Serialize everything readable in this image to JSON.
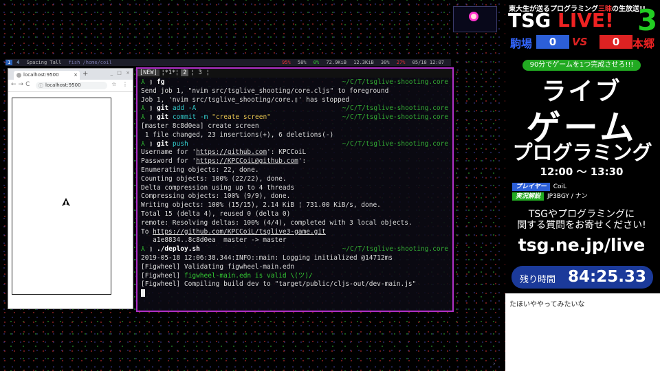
{
  "statusbar": {
    "ws1": "1",
    "ws4": "4",
    "layout": "Spacing Tall",
    "focused": "fish /home/coil",
    "cpu": "95%",
    "mem": "58%",
    "bat": "0%",
    "down": "72.9KiB",
    "up": "12.3KiB",
    "vol": "30%",
    "temp": "27%",
    "datetime": "05/18 12:07"
  },
  "browser": {
    "tab_title": "localhost:9500",
    "url": "localhost:9500",
    "new_tab": "+",
    "tab_close": "×",
    "nav": "←→C",
    "right_icons": "☆ ⋮",
    "win_buttons": "_ □ ×"
  },
  "terminal": {
    "tabs": [
      "[NEW]",
      "¦*1*¦",
      "2",
      "¦",
      "3",
      "¦"
    ],
    "prompt_glyph": "⅄",
    "lines": [
      {
        "kind": "cmd",
        "cmd": "fg",
        "path": "~/C/T/tsglive-shooting.core"
      },
      {
        "kind": "text",
        "text": "Send job 1, \"nvim src/tsglive_shooting/core.cljs\" to foreground"
      },
      {
        "kind": "text",
        "text": "Job 1, 'nvim src/tsglive_shooting/core.▯' has stopped"
      },
      {
        "kind": "cmd",
        "cmd": "git",
        "arg": "add -A",
        "path": "~/C/T/tsglive-shooting.core"
      },
      {
        "kind": "cmd",
        "cmd": "git",
        "arg": "commit -m",
        "str": "\"create screen\"",
        "path": "~/C/T/tsglive-shooting.core"
      },
      {
        "kind": "text",
        "text": "[master 8c8d0ea] create screen"
      },
      {
        "kind": "text",
        "text": " 1 file changed, 23 insertions(+), 6 deletions(-)"
      },
      {
        "kind": "cmd",
        "cmd": "git",
        "arg": "push",
        "path": "~/C/T/tsglive-shooting.core"
      },
      {
        "kind": "mixed",
        "pre": "Username for '",
        "link": "https://github.com",
        "post": "': KPCCoiL"
      },
      {
        "kind": "mixed",
        "pre": "Password for '",
        "link": "https://KPCCoiL@github.com",
        "post": "':"
      },
      {
        "kind": "text",
        "text": "Enumerating objects: 22, done."
      },
      {
        "kind": "text",
        "text": "Counting objects: 100% (22/22), done."
      },
      {
        "kind": "text",
        "text": "Delta compression using up to 4 threads"
      },
      {
        "kind": "text",
        "text": "Compressing objects: 100% (9/9), done."
      },
      {
        "kind": "text",
        "text": "Writing objects: 100% (15/15), 2.14 KiB ¦ 731.00 KiB/s, done."
      },
      {
        "kind": "text",
        "text": "Total 15 (delta 4), reused 0 (delta 0)"
      },
      {
        "kind": "text",
        "text": "remote: Resolving deltas: 100% (4/4), completed with 3 local objects."
      },
      {
        "kind": "mixed",
        "pre": "To ",
        "link": "https://github.com/KPCCoiL/tsglive3-game.git",
        "post": ""
      },
      {
        "kind": "text",
        "text": "   a1e8834..8c8d0ea  master -> master"
      },
      {
        "kind": "cmd",
        "cmd": "./deploy.sh",
        "path": "~/C/T/tsglive-shooting.core"
      },
      {
        "kind": "text",
        "text": "2019-05-18 12:06:38.344:INFO::main: Logging initialized @14712ms"
      },
      {
        "kind": "text",
        "text": "[Figwheel] Validating figwheel-main.edn"
      },
      {
        "kind": "green",
        "pre": "[Figwheel] ",
        "green": "figwheel-main.edn is valid \\(ツ)/"
      },
      {
        "kind": "text",
        "text": "[Figwheel] Compiling build dev to \"target/public/cljs-out/dev-main.js\""
      }
    ]
  },
  "overlay": {
    "subtitle_pre": "東大生が送るプログラミング",
    "subtitle_red": "三昧",
    "subtitle_post": "の生放送!!",
    "logo_tsg": "TSG",
    "logo_live": "LIVE!",
    "logo_num": "3",
    "team_left": "駒場",
    "team_right": "本郷",
    "score_left": "0",
    "score_right": "0",
    "vs": "VS",
    "banner": "90分でゲームを1つ完成させろ!!!",
    "title1": "ライブ",
    "title2": "ゲーム",
    "title3": "プログラミング",
    "time": "12:00 〜 13:30",
    "player_label": "プレイヤー",
    "player": "CoiL",
    "commentary_label": "実況解説",
    "commentary": "JP3BGY / ナン",
    "message_1": "TSGやプログラミングに",
    "message_2": "関する質問をお寄せください!",
    "url": "tsg.ne.jp/live",
    "remain_label": "残り時間",
    "remain_value": "84:25.33"
  },
  "chat": {
    "message": "たほいややってみたいな"
  }
}
